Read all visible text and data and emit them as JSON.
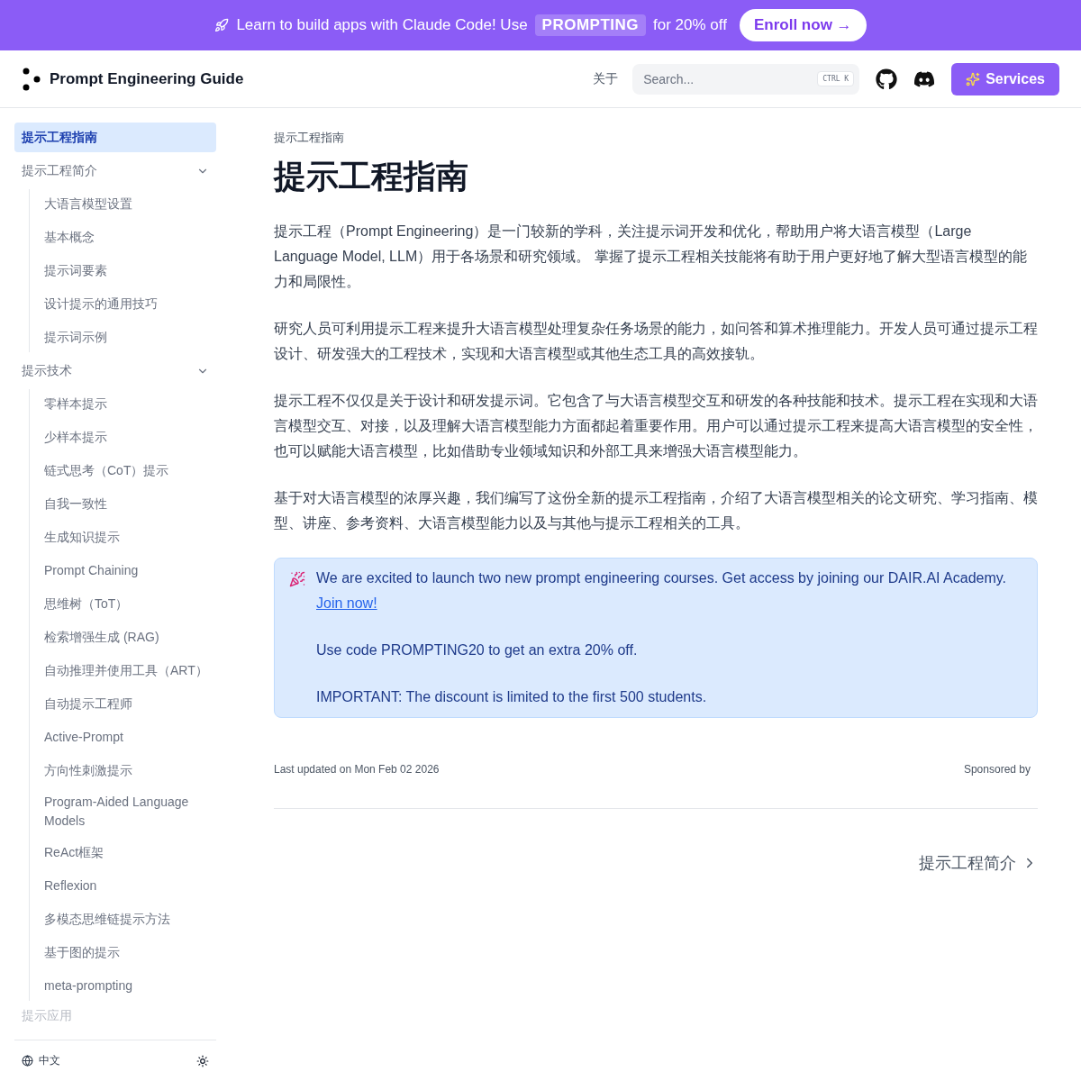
{
  "banner": {
    "text_before": "Learn to build apps with Claude Code! Use",
    "code": "PROMPTING",
    "text_after": "for 20% off",
    "button": "Enroll now →"
  },
  "navbar": {
    "title": "Prompt Engineering Guide",
    "about": "关于",
    "search": {
      "placeholder": "Search...",
      "shortcut": "CTRL K"
    },
    "services": "Services"
  },
  "sidebar": {
    "items": [
      {
        "label": "提示工程指南",
        "selected": true
      },
      {
        "label": "提示工程简介",
        "selected": false,
        "expanded": true,
        "children": [
          {
            "label": "大语言模型设置",
            "selected": false
          },
          {
            "label": "基本概念",
            "selected": false
          },
          {
            "label": "提示词要素",
            "selected": false
          },
          {
            "label": "设计提示的通用技巧",
            "selected": false
          },
          {
            "label": "提示词示例",
            "selected": false
          }
        ]
      },
      {
        "label": "提示技术",
        "selected": false,
        "expanded": true,
        "children": [
          {
            "label": "零样本提示",
            "selected": false
          },
          {
            "label": "少样本提示",
            "selected": false
          },
          {
            "label": "链式思考（CoT）提示",
            "selected": false
          },
          {
            "label": "自我一致性",
            "selected": false
          },
          {
            "label": "生成知识提示",
            "selected": false
          },
          {
            "label": "Prompt Chaining",
            "selected": false
          },
          {
            "label": "思维树（ToT）",
            "selected": false
          },
          {
            "label": "检索增强生成 (RAG)",
            "selected": false
          },
          {
            "label": "自动推理并使用工具（ART）",
            "selected": false
          },
          {
            "label": "自动提示工程师",
            "selected": false
          },
          {
            "label": "Active-Prompt",
            "selected": false
          },
          {
            "label": "方向性刺激提示",
            "selected": false
          },
          {
            "label": "Program-Aided Language Models",
            "selected": false
          },
          {
            "label": "ReAct框架",
            "selected": false
          },
          {
            "label": "Reflexion",
            "selected": false
          },
          {
            "label": "多模态思维链提示方法",
            "selected": false
          },
          {
            "label": "基于图的提示",
            "selected": false
          },
          {
            "label": "meta-prompting",
            "selected": false
          }
        ]
      }
    ],
    "faded_item": "提示应用",
    "language": "中文"
  },
  "content": {
    "breadcrumb": "提示工程指南",
    "title": "提示工程指南",
    "paragraphs": [
      "提示工程（Prompt Engineering）是一门较新的学科，关注提示词开发和优化，帮助用户将大语言模型（Large Language Model, LLM）用于各场景和研究领域。 掌握了提示工程相关技能将有助于用户更好地了解大型语言模型的能力和局限性。",
      "研究人员可利用提示工程来提升大语言模型处理复杂任务场景的能力，如问答和算术推理能力。开发人员可通过提示工程设计、研发强大的工程技术，实现和大语言模型或其他生态工具的高效接轨。",
      "提示工程不仅仅是关于设计和研发提示词。它包含了与大语言模型交互和研发的各种技能和技术。提示工程在实现和大语言模型交互、对接，以及理解大语言模型能力方面都起着重要作用。用户可以通过提示工程来提高大语言模型的安全性，也可以赋能大语言模型，比如借助专业领域知识和外部工具来增强大语言模型能力。",
      "基于对大语言模型的浓厚兴趣，我们编写了这份全新的提示工程指南，介绍了大语言模型相关的论文研究、学习指南、模型、讲座、参考资料、大语言模型能力以及与其他与提示工程相关的工具。"
    ],
    "callout": {
      "text_before": "We are excited to launch two new prompt engineering courses. Get access by joining our DAIR.AI Academy.",
      "link": "Join now!",
      "lines": [
        "Use code PROMPTING20 to get an extra 20% off.",
        "IMPORTANT: The discount is limited to the first 500 students."
      ]
    },
    "last_updated": "Last updated on Mon Feb 02 2026",
    "sponsored": "Sponsored by",
    "next_page": "提示工程简介"
  }
}
